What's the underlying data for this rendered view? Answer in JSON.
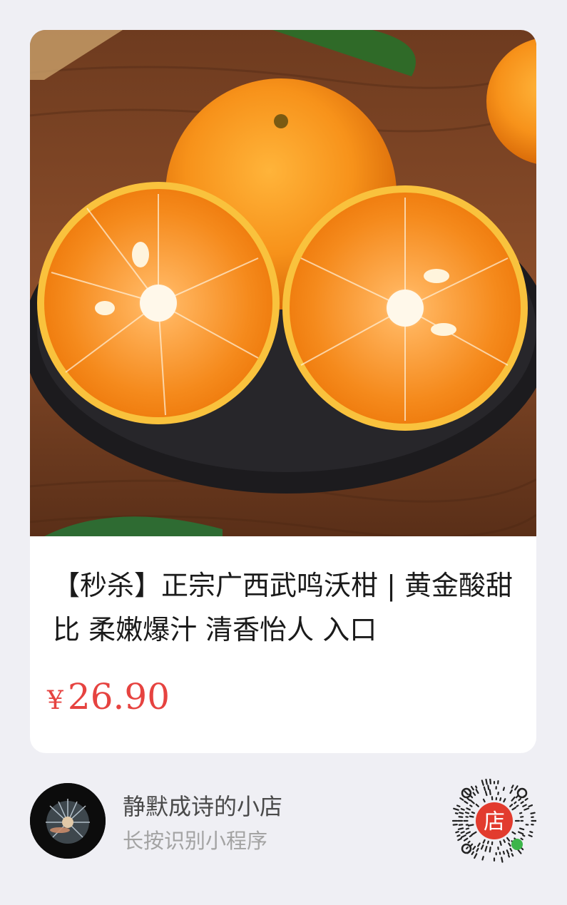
{
  "product": {
    "title": "【秒杀】正宗广西武鸣沃柑 | 黄金酸甜比 柔嫩爆汁 清香怡人 入口",
    "price_symbol": "¥",
    "price": "26.90"
  },
  "shop": {
    "name": "静默成诗的小店",
    "hint": "长按识别小程序",
    "qr_badge": "店"
  },
  "colors": {
    "price": "#e64340",
    "qr_red": "#e23b2e",
    "qr_green": "#3cb54a"
  },
  "icons": {
    "product_image": "orange-fruit-photo",
    "avatar": "dandelion-avatar",
    "qr": "mini-program-code"
  }
}
